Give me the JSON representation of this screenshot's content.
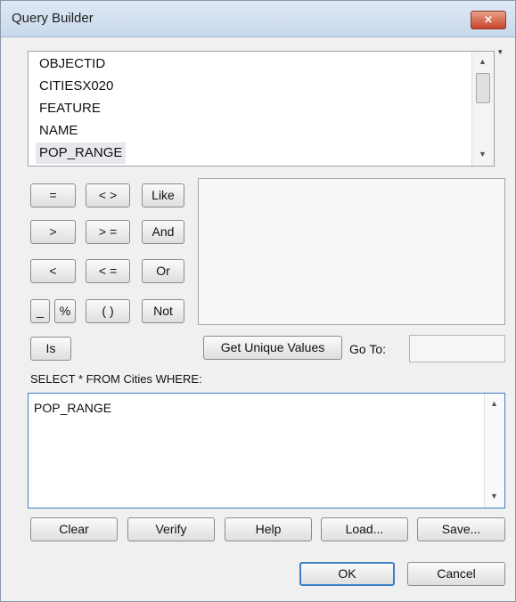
{
  "window": {
    "title": "Query Builder",
    "close_glyph": "×"
  },
  "fields": [
    "OBJECTID",
    "CITIESX020",
    "FEATURE",
    "NAME",
    "POP_RANGE"
  ],
  "selected_field": "POP_RANGE",
  "list_dropdown_glyph": "▾",
  "scroll_glyphs": {
    "up": "▲",
    "down": "▼"
  },
  "operators": {
    "equals": "=",
    "not_equals": "< >",
    "like": "Like",
    "greater": ">",
    "greater_equal": "> =",
    "and": "And",
    "less": "<",
    "less_equal": "< =",
    "or": "Or",
    "underscore": "_",
    "percent": "%",
    "parens": "( )",
    "not": "Not",
    "is": "Is"
  },
  "get_unique_values": "Get Unique Values",
  "goto_label": "Go To:",
  "goto_value": "",
  "where_label": "SELECT * FROM Cities WHERE:",
  "where_clause": "POP_RANGE",
  "buttons": {
    "clear": "Clear",
    "verify": "Verify",
    "help": "Help",
    "load": "Load...",
    "save": "Save...",
    "ok": "OK",
    "cancel": "Cancel"
  },
  "icons": {
    "close": "close-icon",
    "scroll_up": "scroll-up-icon",
    "scroll_down": "scroll-down-icon"
  }
}
